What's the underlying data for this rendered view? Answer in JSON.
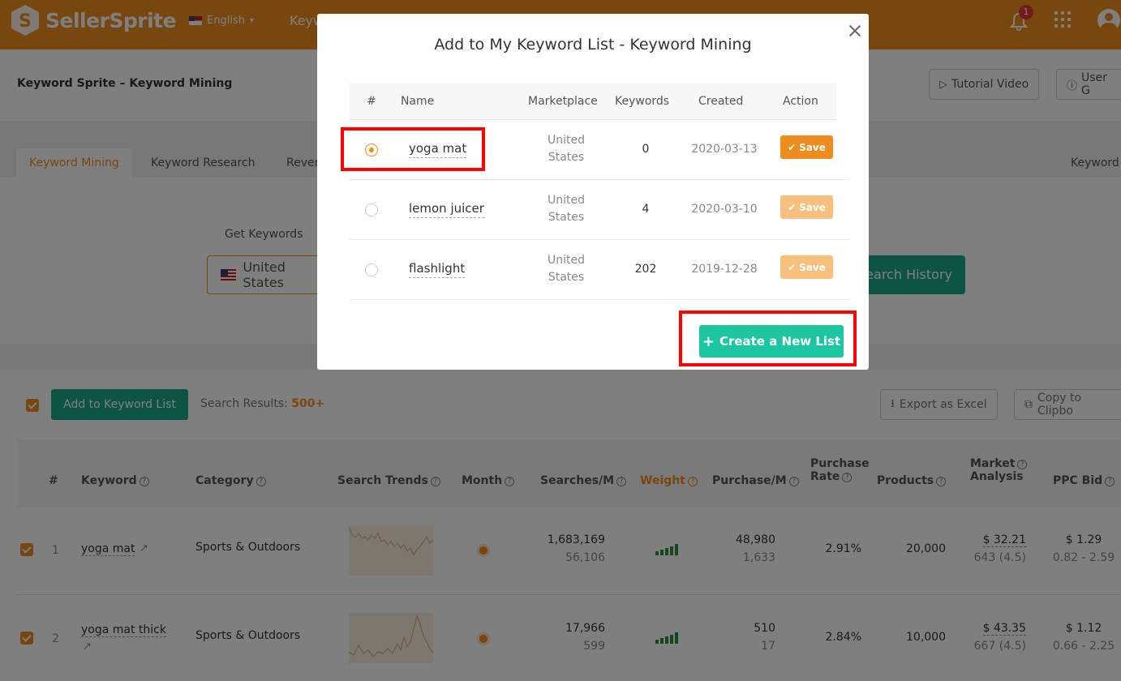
{
  "header": {
    "logo_text": "SellerSprite",
    "language": "English",
    "nav_partial": "Keyw",
    "notification_count": "1"
  },
  "page": {
    "title": "Keyword Sprite – Keyword Mining",
    "tutorial_video": "Tutorial Video",
    "user_guide": "User G"
  },
  "tabs": [
    {
      "label": "Keyword Mining",
      "active": true
    },
    {
      "label": "Keyword Research",
      "active": false
    },
    {
      "label": "Rever",
      "active": false
    },
    {
      "label": "Keyword",
      "active": false
    }
  ],
  "search": {
    "get_keywords_label": "Get Keywords",
    "marketplace": "United States",
    "search_history": "Search History"
  },
  "results": {
    "add_to_list": "Add to Keyword List",
    "search_results_label": "Search Results:",
    "search_results_count": "500+",
    "export_excel": "Export as Excel",
    "copy_clipboard": "Copy to Clipbo"
  },
  "table": {
    "columns": {
      "num": "#",
      "keyword": "Keyword",
      "category": "Category",
      "search_trends": "Search Trends",
      "month": "Month",
      "searches": "Searches/M",
      "weight": "Weight",
      "purchase_m": "Purchase/M",
      "purchase_rate_1": "Purchase",
      "purchase_rate_2": "Rate",
      "products": "Products",
      "market_1": "Market",
      "market_2": "Analysis",
      "ppc": "PPC Bid"
    },
    "rows": [
      {
        "num": "1",
        "keyword": "yoga mat",
        "category": "Sports & Outdoors",
        "searches": "1,683,169",
        "searches_sub": "56,106",
        "purchase": "48,980",
        "purchase_sub": "1,633",
        "rate": "2.91%",
        "products": "20,000",
        "market": "$ 32.21",
        "market_sub": "643 (4.5)",
        "ppc": "$ 1.29",
        "ppc_sub": "0.82 - 2.59"
      },
      {
        "num": "2",
        "keyword": "yoga mat thick",
        "category": "Sports & Outdoors",
        "searches": "17,966",
        "searches_sub": "599",
        "purchase": "510",
        "purchase_sub": "17",
        "rate": "2.84%",
        "products": "10,000",
        "market": "$ 43.35",
        "market_sub": "667 (4.5)",
        "ppc": "$ 1.12",
        "ppc_sub": "0.66 - 2.25"
      }
    ]
  },
  "modal": {
    "title": "Add to My Keyword List - Keyword Mining",
    "columns": {
      "num": "#",
      "name": "Name",
      "marketplace": "Marketplace",
      "keywords": "Keywords",
      "created": "Created",
      "action": "Action"
    },
    "lists": [
      {
        "name": "yoga mat",
        "market_1": "United",
        "market_2": "States",
        "keywords": "0",
        "created": "2020-03-13",
        "selected": true,
        "action": "Save"
      },
      {
        "name": "lemon juicer",
        "market_1": "United",
        "market_2": "States",
        "keywords": "4",
        "created": "2020-03-10",
        "selected": false,
        "action": "Save"
      },
      {
        "name": "flashlight",
        "market_1": "United",
        "market_2": "States",
        "keywords": "202",
        "created": "2019-12-28",
        "selected": false,
        "action": "Save"
      }
    ],
    "create_button": "Create a New List"
  },
  "colors": {
    "brand": "#f08c1e",
    "teal": "#1aa98a",
    "create": "#1cc6a0",
    "highlight": "#ff0000"
  }
}
